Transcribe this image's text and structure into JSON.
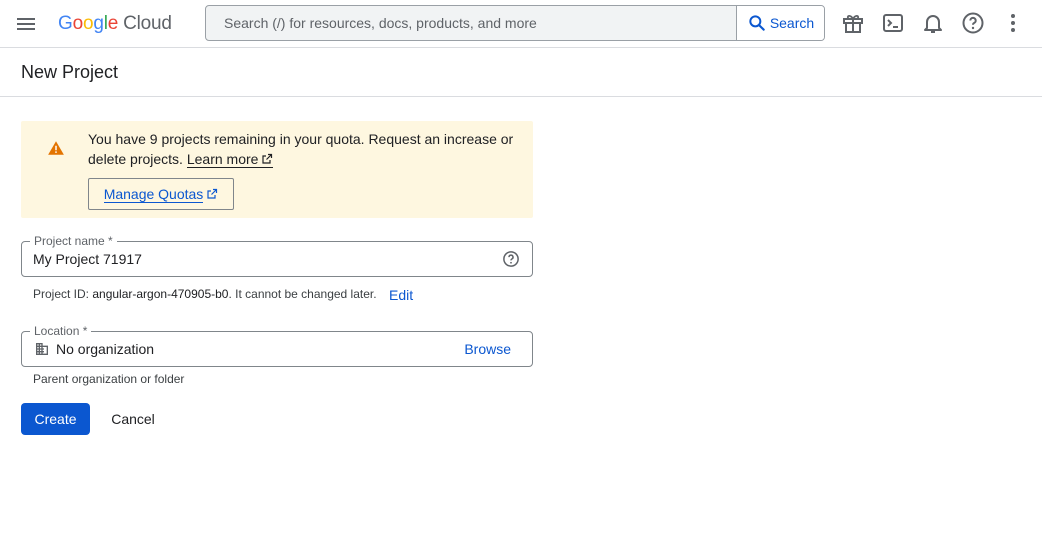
{
  "app": {
    "logo_parts": [
      "G",
      "o",
      "o",
      "g",
      "l",
      "e"
    ],
    "logo_product": "Cloud"
  },
  "search": {
    "placeholder": "Search (/) for resources, docs, products, and more",
    "button_label": "Search"
  },
  "topbar_icons": [
    "menu-icon",
    "gift-icon",
    "cloud-shell-icon",
    "notifications-icon",
    "help-icon",
    "more-vert-icon"
  ],
  "page": {
    "title": "New Project"
  },
  "banner": {
    "text_before": "You have 9 projects remaining in your quota. Request an increase or delete projects.",
    "learn_more": "Learn more",
    "manage_quotas": "Manage Quotas",
    "icon": "warning-icon",
    "icon_color": "#e37400",
    "background": "#fef7e0"
  },
  "project_name": {
    "label": "Project name *",
    "value": "My Project 71917"
  },
  "project_id": {
    "prefix": "Project ID:",
    "id": "angular-argon-470905-b0",
    "suffix": ". It cannot be changed later.",
    "edit": "Edit"
  },
  "location": {
    "label": "Location *",
    "value": "No organization",
    "browse": "Browse",
    "hint": "Parent organization or folder"
  },
  "actions": {
    "create": "Create",
    "cancel": "Cancel"
  },
  "colors": {
    "primary": "#0b57d0",
    "border": "#80868b"
  }
}
